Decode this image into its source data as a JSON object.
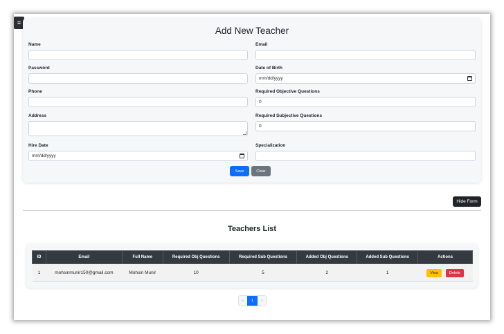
{
  "menu_toggle": {
    "icon": "hamburger-icon",
    "glyph": "≡"
  },
  "form": {
    "title": "Add New Teacher",
    "fields": {
      "name": {
        "label": "Name",
        "value": ""
      },
      "email": {
        "label": "Email",
        "value": ""
      },
      "password": {
        "label": "Password",
        "value": ""
      },
      "dob": {
        "label": "Date of Birth",
        "value": "mm/dd/yyyy"
      },
      "phone": {
        "label": "Phone",
        "value": ""
      },
      "req_obj": {
        "label": "Required Objective Questions",
        "value": "0"
      },
      "address": {
        "label": "Address",
        "value": ""
      },
      "req_sub": {
        "label": "Required Subjective Questions",
        "value": "0"
      },
      "hire_date": {
        "label": "Hire Date",
        "value": "mm/dd/yyyy"
      },
      "specialization": {
        "label": "Specialization",
        "value": ""
      }
    },
    "save_label": "Save",
    "clear_label": "Clear"
  },
  "hide_form_label": "Hide Form",
  "list": {
    "title": "Teachers List",
    "columns": [
      "ID",
      "Email",
      "Full Name",
      "Required Obj Questions",
      "Required Sub Questions",
      "Added Obj Questions",
      "Added Sub Questions",
      "Actions"
    ],
    "rows": [
      {
        "id": "1",
        "email": "mohsinmunir150@gmail.com",
        "full_name": "Mohsin Munir",
        "req_obj": "10",
        "req_sub": "5",
        "added_obj": "2",
        "added_sub": "1",
        "view_label": "View",
        "delete_label": "Delete"
      }
    ]
  },
  "pagination": {
    "prev": "‹",
    "current": "1",
    "next": "›"
  },
  "colors": {
    "primary": "#0d6efd",
    "secondary": "#6c757d",
    "dark": "#212529",
    "warning": "#ffc107",
    "danger": "#dc3545"
  }
}
